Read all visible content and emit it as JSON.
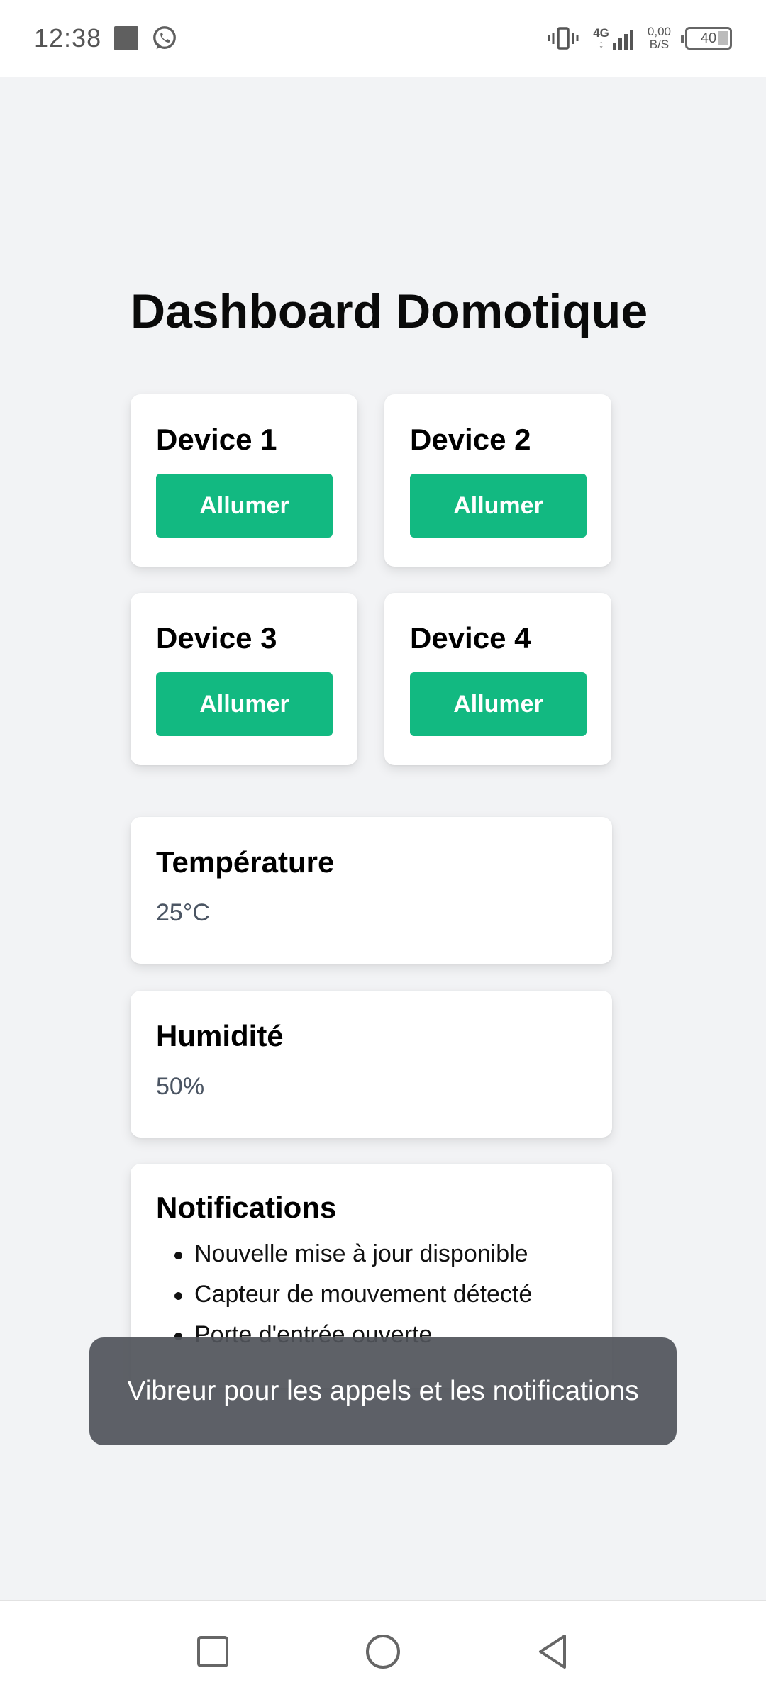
{
  "status_bar": {
    "time": "12:38",
    "network_type": "4G",
    "network_sub": "↕",
    "speed_value": "0,00",
    "speed_unit": "B/S",
    "battery_level": "40"
  },
  "page": {
    "title": "Dashboard Domotique"
  },
  "devices": [
    {
      "name": "Device 1",
      "button_label": "Allumer"
    },
    {
      "name": "Device 2",
      "button_label": "Allumer"
    },
    {
      "name": "Device 3",
      "button_label": "Allumer"
    },
    {
      "name": "Device 4",
      "button_label": "Allumer"
    }
  ],
  "temperature": {
    "title": "Température",
    "value": "25°C"
  },
  "humidity": {
    "title": "Humidité",
    "value": "50%"
  },
  "notifications": {
    "title": "Notifications",
    "items": [
      "Nouvelle mise à jour disponible",
      "Capteur de mouvement détecté",
      "Porte d'entrée ouverte"
    ]
  },
  "toast": {
    "message": "Vibreur pour les appels et les notifications"
  },
  "colors": {
    "accent": "#12b981",
    "background": "#f2f3f5",
    "card": "#ffffff"
  }
}
